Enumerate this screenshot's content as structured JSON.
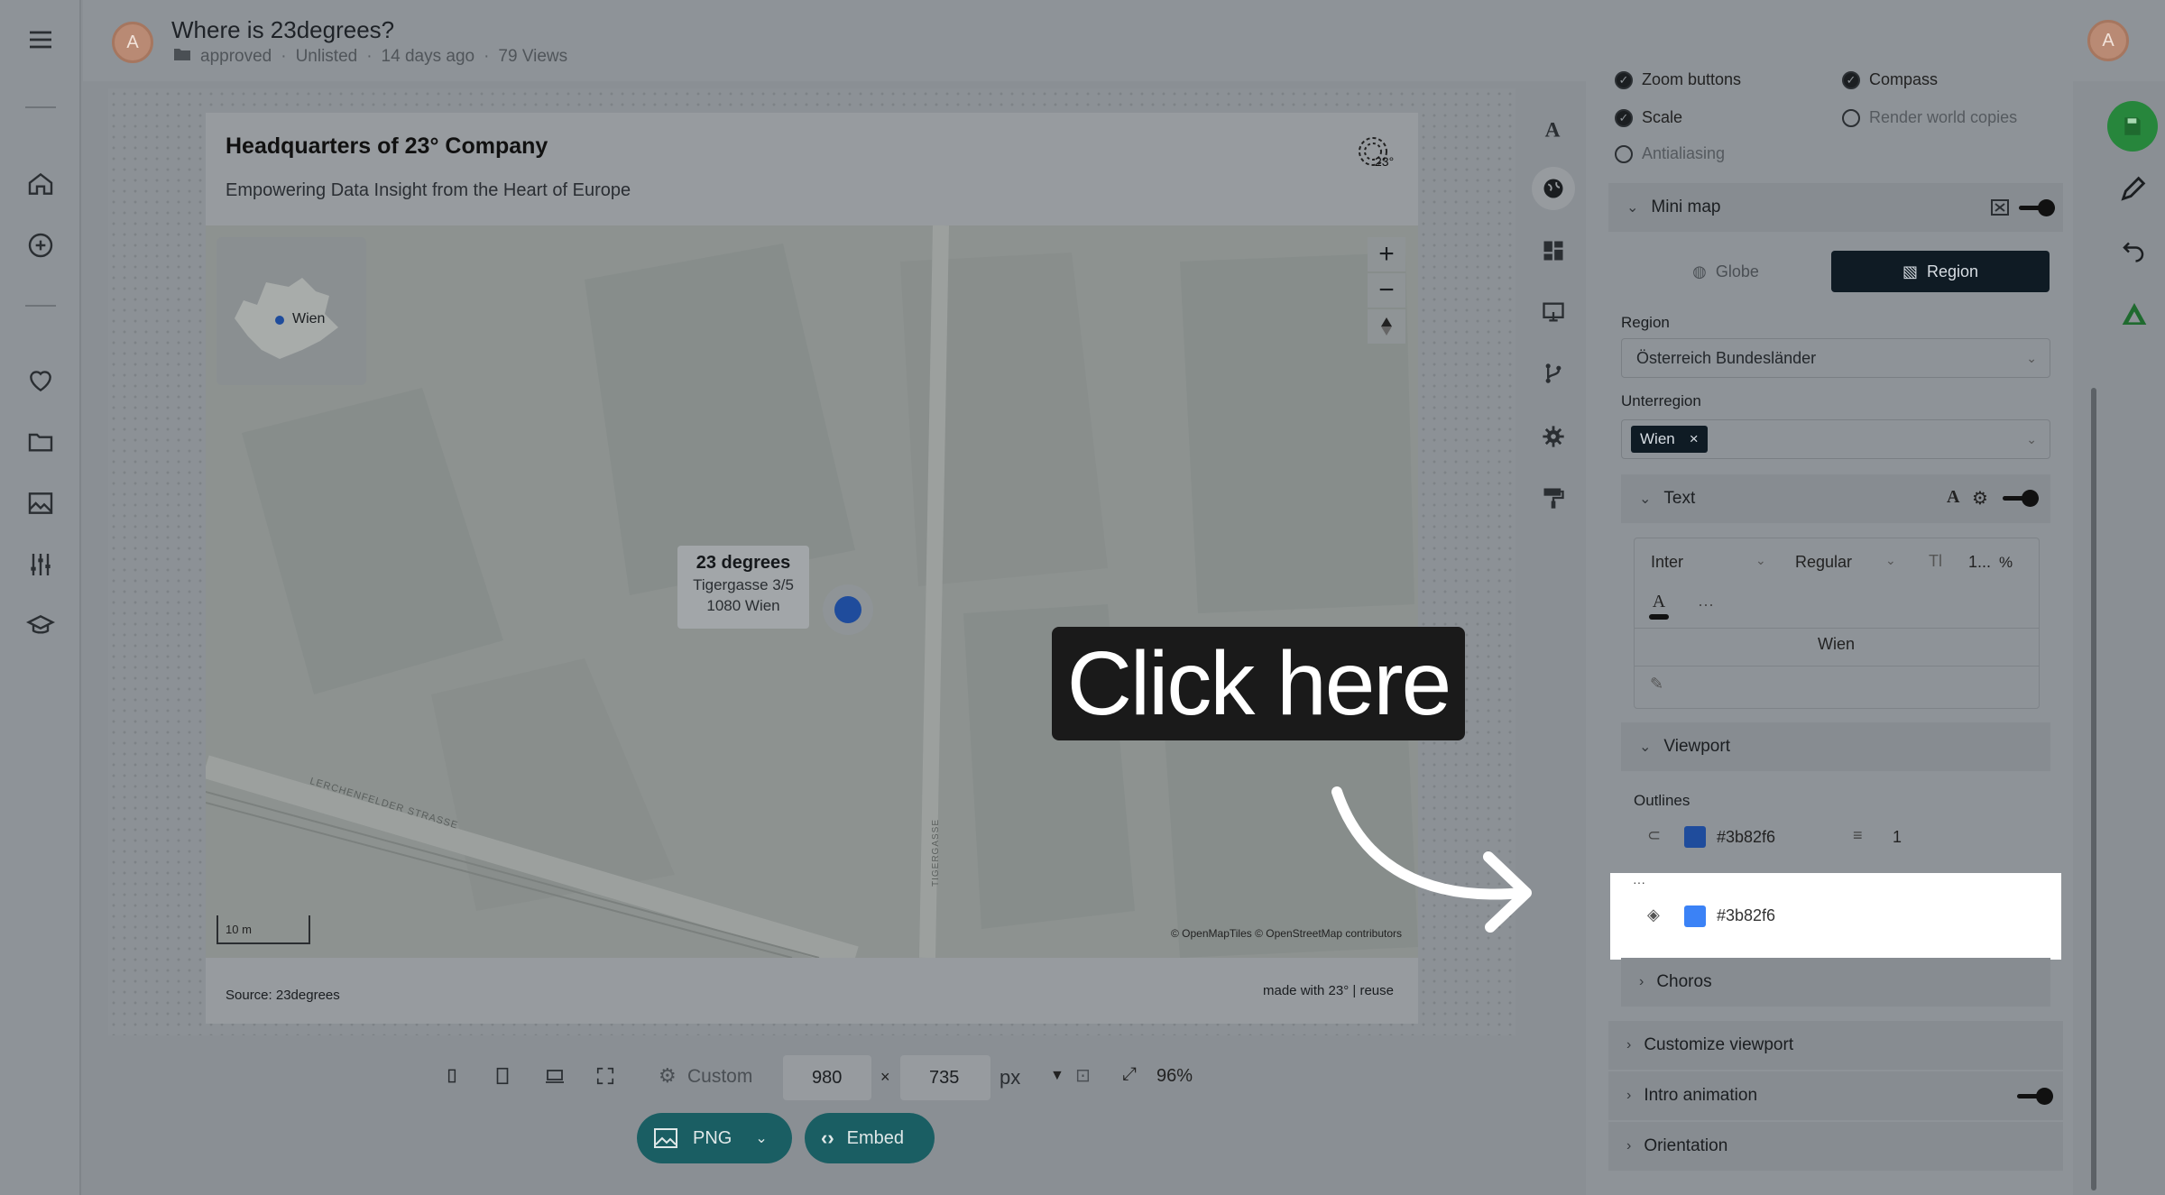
{
  "header": {
    "avatar_letter": "A",
    "title": "Where is 23degrees?",
    "status": "approved",
    "visibility": "Unlisted",
    "age": "14 days ago",
    "views": "79 Views"
  },
  "card": {
    "title": "Headquarters of 23° Company",
    "subtitle": "Empowering Data Insight from the Heart of Europe",
    "source": "Source: 23degrees",
    "made_with": "made with 23° | reuse"
  },
  "map": {
    "minimap_label": "Wien",
    "popup": {
      "name": "23 degrees",
      "street": "Tigergasse 3/5",
      "city": "1080 Wien"
    },
    "scale_label": "10 m",
    "attribution": "© OpenMapTiles © OpenStreetMap contributors",
    "zoom_in": "+",
    "zoom_out": "−",
    "street_label_1": "LERCHENFELDER STRASSE",
    "street_label_2": "TIGERGASSE"
  },
  "panel": {
    "opt_zoom_buttons": "Zoom buttons",
    "opt_compass": "Compass",
    "opt_scale": "Scale",
    "opt_render_world": "Render world copies",
    "opt_antialiasing": "Antialiasing",
    "minimap_section": "Mini map",
    "tab_globe": "Globe",
    "tab_region": "Region",
    "region_label": "Region",
    "region_value": "Österreich Bundesländer",
    "subregion_label": "Unterregion",
    "subregion_chip": "Wien",
    "text_section": "Text",
    "font_family": "Inter",
    "font_weight": "Regular",
    "font_size": "1...",
    "font_unit": "%",
    "text_value": "Wien",
    "viewport_section": "Viewport",
    "outlines_label": "Outlines",
    "outline_color": "#3b82f6",
    "outline_width": "1",
    "fill_color": "#3b82f6",
    "choros_section": "Choros",
    "customize_section": "Customize viewport",
    "intro_section": "Intro animation",
    "orientation_section": "Orientation"
  },
  "callout": {
    "text": "Click here"
  },
  "bottom": {
    "preset": "Custom",
    "width": "980",
    "height": "735",
    "times": "×",
    "unit": "px",
    "zoom": "96%",
    "png_label": "PNG",
    "embed_label": "Embed"
  },
  "colors": {
    "accent_teal": "#1a5e63",
    "save_green": "#27863c",
    "outline_blue": "#3b82f6",
    "dark_tab": "#0f1b24"
  }
}
